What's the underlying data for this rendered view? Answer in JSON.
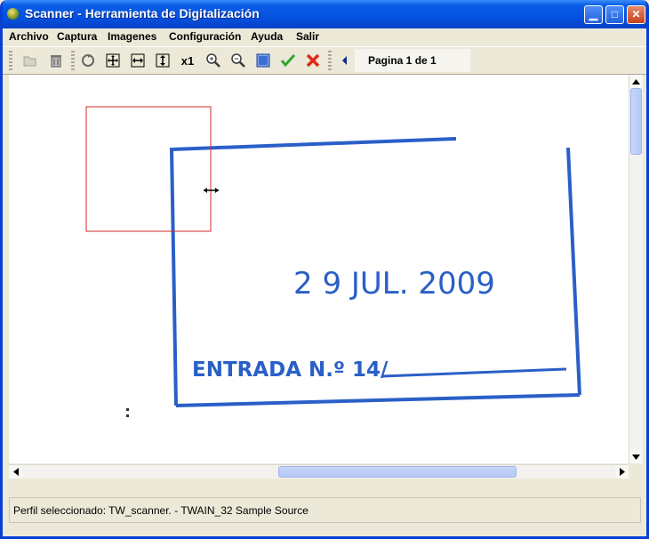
{
  "window": {
    "title": "Scanner - Herramienta de Digitalización"
  },
  "menu": [
    "Archivo",
    "Captura",
    "Imagenes",
    "Configuración",
    "Ayuda",
    "Salir"
  ],
  "toolbar": {
    "icons": [
      "open-folder-icon",
      "trash-icon",
      "rotate-icon",
      "fit-page-icon",
      "fit-width-icon",
      "fit-height-icon",
      "actual-size-icon",
      "zoom-in-icon",
      "zoom-out-icon",
      "select-area-icon",
      "accept-icon",
      "cancel-icon",
      "previous-page-icon",
      "next-page-icon"
    ],
    "actual_size_label": "x1",
    "page_label": "Pagina 1 de 1"
  },
  "document": {
    "stamp_date": "2 9  JUL. 2009",
    "stamp_entry": "ENTRADA N.º 14/",
    "stamp_color": "#2a5fc7",
    "selection_color": "#d22a2a"
  },
  "status": {
    "text": "Perfil seleccionado: TW_scanner. - TWAIN_32 Sample Source"
  }
}
